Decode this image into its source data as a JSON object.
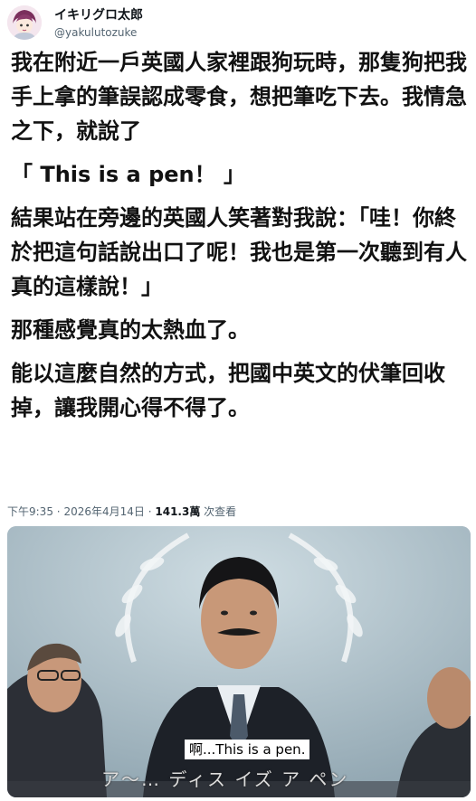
{
  "author": {
    "display_name": "イキリグロ太郎",
    "handle": "@yakulutozuke"
  },
  "tweet": {
    "paragraphs": [
      "我在附近一戶英國人家裡跟狗玩時，那隻狗把我手上拿的筆誤認成零食，想把筆吃下去。我情急之下，就說了",
      "「 This is a pen！ 」",
      "結果站在旁邊的英國人笑著對我說：「哇！你終於把這句話說出口了呢！我也是第一次聽到有人真的這樣說！」",
      "那種感覺真的太熱血了。",
      "能以這麼自然的方式，把國中英文的伏筆回收掉，讓我開心得不得了。"
    ]
  },
  "meta": {
    "time": "下午9:35",
    "date": "2026年4月14日",
    "separator": "·",
    "views_count": "141.3萬",
    "views_label": "次查看"
  },
  "media": {
    "subtitle": "啊...This is a pen.",
    "jp_caption": "ア〜… ディス イズ ア ペン"
  }
}
